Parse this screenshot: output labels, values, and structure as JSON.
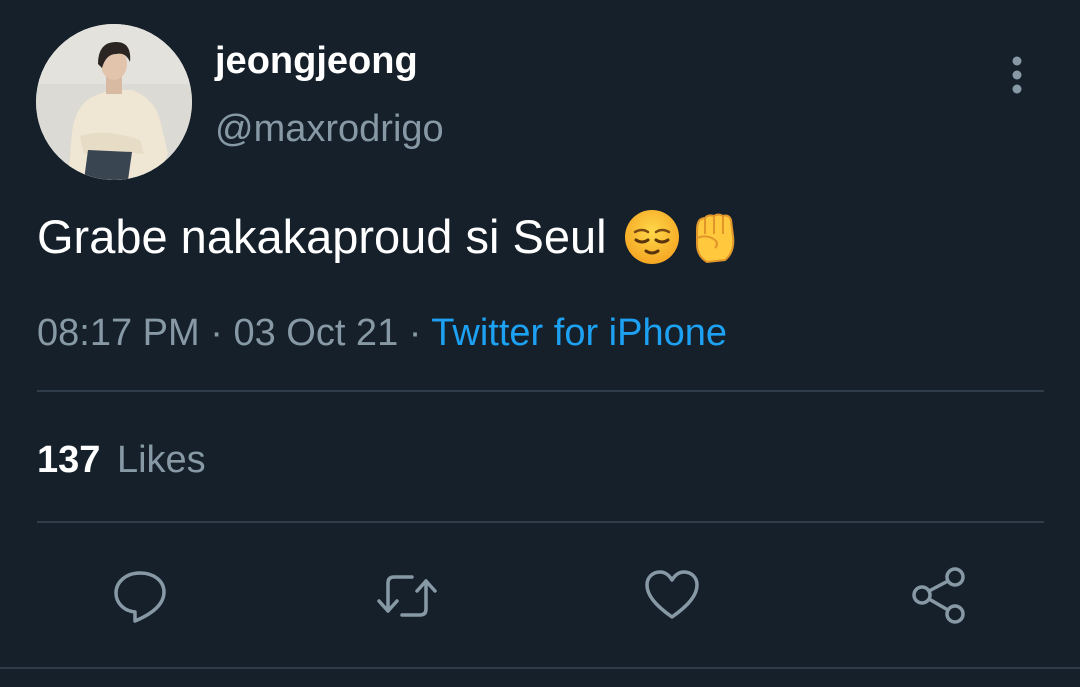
{
  "tweet": {
    "author": {
      "display_name": "jeongjeong",
      "handle": "@maxrodrigo"
    },
    "text": "Grabe nakakaproud si Seul",
    "emojis": [
      "relieved-face-emoji",
      "raised-fist-emoji"
    ],
    "time": "08:17 PM",
    "separator": "·",
    "date": "03 Oct 21",
    "source": "Twitter for iPhone"
  },
  "stats": {
    "likes_count": "137",
    "likes_label": "Likes"
  },
  "actions": {
    "reply_icon": "reply-icon",
    "retweet_icon": "retweet-icon",
    "like_icon": "like-icon",
    "share_icon": "share-icon"
  },
  "colors": {
    "background": "#15202b",
    "text_primary": "#ffffff",
    "text_secondary": "#8899a6",
    "accent": "#1da1f2",
    "divider": "#2f3d4a"
  }
}
